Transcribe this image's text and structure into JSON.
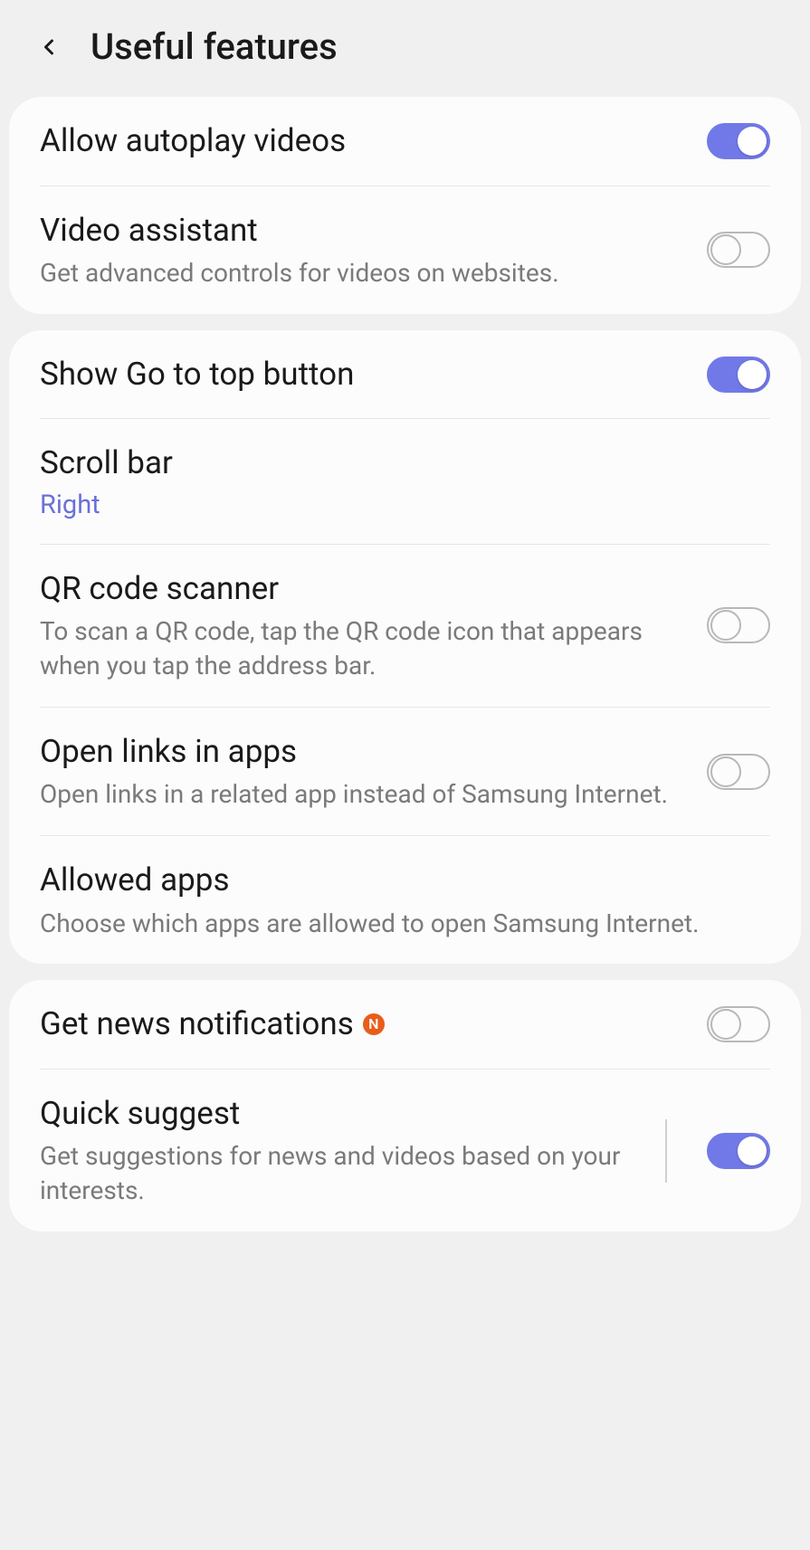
{
  "header": {
    "title": "Useful features"
  },
  "groups": [
    {
      "items": [
        {
          "title": "Allow autoplay videos",
          "subtitle": null,
          "toggle": true
        },
        {
          "title": "Video assistant",
          "subtitle": "Get advanced controls for videos on websites.",
          "toggle": false
        }
      ]
    },
    {
      "items": [
        {
          "title": "Show Go to top button",
          "subtitle": null,
          "toggle": true
        },
        {
          "title": "Scroll bar",
          "value": "Right"
        },
        {
          "title": "QR code scanner",
          "subtitle": "To scan a QR code, tap the QR code icon that appears when you tap the address bar.",
          "toggle": false
        },
        {
          "title": "Open links in apps",
          "subtitle": "Open links in a related app instead of Samsung Internet.",
          "toggle": false
        },
        {
          "title": "Allowed apps",
          "subtitle": "Choose which apps are allowed to open Samsung Internet."
        }
      ]
    },
    {
      "items": [
        {
          "title": "Get news notifications",
          "badge": "N",
          "toggle": false
        },
        {
          "title": "Quick suggest",
          "subtitle": "Get suggestions for news and videos based on your interests.",
          "toggle": true,
          "separator": true
        }
      ]
    }
  ]
}
